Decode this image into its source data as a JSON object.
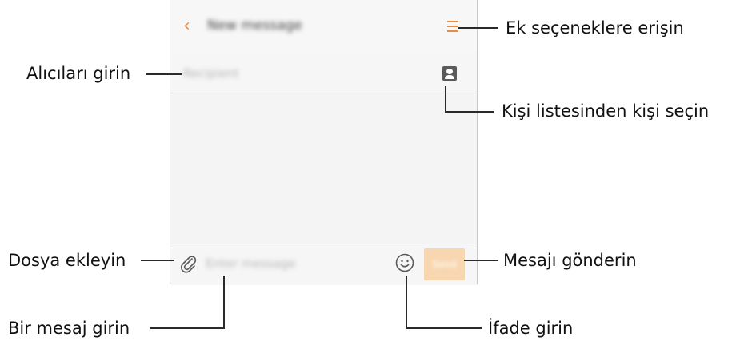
{
  "screen": {
    "title": "New message",
    "recipient_placeholder": "Recipient",
    "message_placeholder": "Enter message",
    "send_label": "Send"
  },
  "callouts": {
    "more_options": "Ek seçeneklere erişin",
    "enter_recipients": "Alıcıları girin",
    "select_contacts": "Kişi listesinden kişi seçin",
    "attach_files": "Dosya ekleyin",
    "send_message": "Mesajı gönderin",
    "enter_message": "Bir mesaj girin",
    "enter_emoticons": "İfade girin"
  },
  "colors": {
    "accent": "#f08a3c",
    "send_button": "#f8d7b0",
    "callout_line": "#2a2a2a"
  },
  "icons": {
    "back": "chevron-left-icon",
    "menu": "menu-icon",
    "contacts": "contact-icon",
    "attach": "paperclip-icon",
    "emoji": "emoji-icon"
  }
}
